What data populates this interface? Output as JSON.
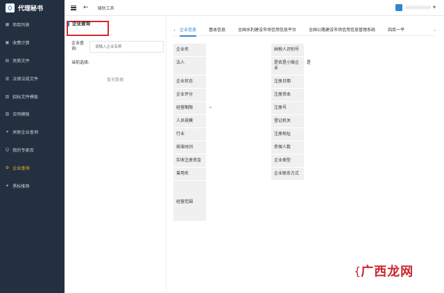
{
  "app": {
    "logo_text": "代理秘书"
  },
  "sidebar": {
    "items": [
      {
        "label": "项目列表",
        "icon": "grid-icon"
      },
      {
        "label": "收费计算",
        "icon": "calculator-icon"
      },
      {
        "label": "资质文件",
        "icon": "document-icon"
      },
      {
        "label": "法律法规文件",
        "icon": "book-icon"
      },
      {
        "label": "招标文件模板",
        "icon": "template-icon"
      },
      {
        "label": "合同模板",
        "icon": "contract-icon"
      },
      {
        "label": "关联企业查询",
        "icon": "link-icon"
      },
      {
        "label": "我的专家库",
        "icon": "expert-icon"
      },
      {
        "label": "企业查询",
        "icon": "gear-icon",
        "active": true
      },
      {
        "label": "黑标推荐",
        "icon": "star-icon"
      }
    ]
  },
  "header": {
    "title": "辅助工具",
    "user": "XXXXXXXXX"
  },
  "left": {
    "title": "企业查询",
    "query_label": "企业查询:",
    "query_placeholder": "请输入企业名称",
    "current_label": "当前选择:",
    "no_data": "暂无数据"
  },
  "tabs": [
    "企业信息",
    "基本信息",
    "全国水利建设市场信用信息平台",
    "全国公路建设市场信用信息管理系统",
    "四库一平"
  ],
  "info": {
    "rows": [
      {
        "l1": "企业名",
        "v1": "",
        "l2": "纳税人识别号",
        "v2": ""
      },
      {
        "l1": "法人",
        "v1": "",
        "l2": "是否是小微企业",
        "v2": "是"
      },
      {
        "l1": "企业状态",
        "v1": "",
        "l2": "注册日期",
        "v2": ""
      },
      {
        "l1": "企业评分",
        "v1": "",
        "l2": "注册资本",
        "v2": ""
      },
      {
        "l1": "经营期限",
        "v1": "~",
        "l2": "注册号",
        "v2": ""
      },
      {
        "l1": "人员规模",
        "v1": "",
        "l2": "登记机关",
        "v2": ""
      },
      {
        "l1": "行业",
        "v1": "",
        "l2": "注册地址",
        "v2": ""
      },
      {
        "l1": "核准时间",
        "v1": "",
        "l2": "参保人数",
        "v2": ""
      },
      {
        "l1": "实收注册资金",
        "v1": "",
        "l2": "企业类型",
        "v2": ""
      },
      {
        "l1": "曾用名",
        "v1": "",
        "l2": "企业联系方式",
        "v2": ""
      }
    ],
    "scope_label": "经营范围"
  },
  "watermark": {
    "text": "广西龙网"
  }
}
